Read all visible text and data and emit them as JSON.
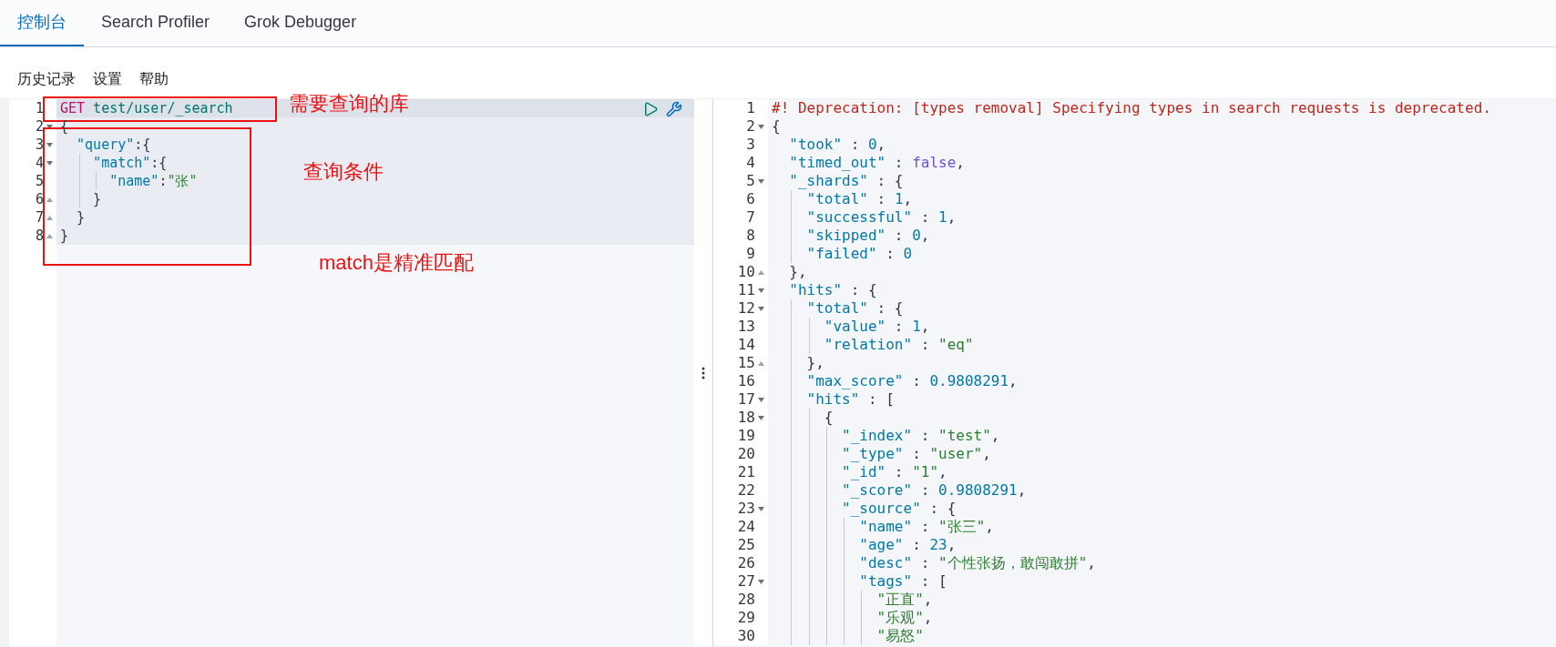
{
  "tabs": [
    {
      "label": "控制台",
      "selected": true
    },
    {
      "label": "Search Profiler",
      "selected": false
    },
    {
      "label": "Grok Debugger",
      "selected": false
    }
  ],
  "toolbar": [
    "历史记录",
    "设置",
    "帮助"
  ],
  "editor": {
    "request_selected": true,
    "lines": [
      {
        "n": "1",
        "active": true,
        "fold_start": false,
        "fold_end": false,
        "tokens": [
          {
            "kind": "method",
            "text": "GET"
          },
          {
            "kind": "path",
            "text": " test/user/_search"
          }
        ]
      },
      {
        "n": "2",
        "active": false,
        "fold_start": true,
        "fold_end": false,
        "tokens": [
          {
            "kind": "punct",
            "text": "{"
          }
        ]
      },
      {
        "n": "3",
        "active": false,
        "fold_start": true,
        "fold_end": false,
        "tokens": [
          {
            "kind": "key",
            "text": "  \"query\""
          },
          {
            "kind": "punct",
            "text": ":{"
          }
        ]
      },
      {
        "n": "4",
        "active": false,
        "fold_start": true,
        "fold_end": false,
        "tokens": [
          {
            "kind": "key",
            "text": "    \"match\""
          },
          {
            "kind": "punct",
            "text": ":{"
          }
        ]
      },
      {
        "n": "5",
        "active": false,
        "fold_start": false,
        "fold_end": false,
        "tokens": [
          {
            "kind": "key",
            "text": "      \"name\""
          },
          {
            "kind": "punct",
            "text": ":"
          },
          {
            "kind": "string",
            "text": "\"张\""
          }
        ]
      },
      {
        "n": "6",
        "active": false,
        "fold_start": false,
        "fold_end": true,
        "tokens": [
          {
            "kind": "punct",
            "text": "    }"
          }
        ]
      },
      {
        "n": "7",
        "active": false,
        "fold_start": false,
        "fold_end": true,
        "tokens": [
          {
            "kind": "punct",
            "text": "  }"
          }
        ]
      },
      {
        "n": "8",
        "active": false,
        "fold_start": false,
        "fold_end": true,
        "tokens": [
          {
            "kind": "punct",
            "text": "}"
          }
        ]
      }
    ]
  },
  "annotations": [
    "需要查询的库",
    "查询条件",
    "match是精准匹配"
  ],
  "output": {
    "lines": [
      {
        "n": "1",
        "fold_start": false,
        "fold_end": false,
        "tokens": [
          {
            "kind": "comment",
            "text": "#! Deprecation: [types removal] Specifying types in search requests is deprecated."
          }
        ]
      },
      {
        "n": "2",
        "fold_start": true,
        "fold_end": false,
        "tokens": [
          {
            "kind": "punct",
            "text": "{"
          }
        ]
      },
      {
        "n": "3",
        "fold_start": false,
        "fold_end": false,
        "tokens": [
          {
            "kind": "key",
            "text": "  \"took\""
          },
          {
            "kind": "punct",
            "text": " : "
          },
          {
            "kind": "number",
            "text": "0"
          },
          {
            "kind": "punct",
            "text": ","
          }
        ]
      },
      {
        "n": "4",
        "fold_start": false,
        "fold_end": false,
        "tokens": [
          {
            "kind": "key",
            "text": "  \"timed_out\""
          },
          {
            "kind": "punct",
            "text": " : "
          },
          {
            "kind": "bool",
            "text": "false"
          },
          {
            "kind": "punct",
            "text": ","
          }
        ]
      },
      {
        "n": "5",
        "fold_start": true,
        "fold_end": false,
        "tokens": [
          {
            "kind": "key",
            "text": "  \"_shards\""
          },
          {
            "kind": "punct",
            "text": " : {"
          }
        ]
      },
      {
        "n": "6",
        "fold_start": false,
        "fold_end": false,
        "tokens": [
          {
            "kind": "key",
            "text": "    \"total\""
          },
          {
            "kind": "punct",
            "text": " : "
          },
          {
            "kind": "number",
            "text": "1"
          },
          {
            "kind": "punct",
            "text": ","
          }
        ]
      },
      {
        "n": "7",
        "fold_start": false,
        "fold_end": false,
        "tokens": [
          {
            "kind": "key",
            "text": "    \"successful\""
          },
          {
            "kind": "punct",
            "text": " : "
          },
          {
            "kind": "number",
            "text": "1"
          },
          {
            "kind": "punct",
            "text": ","
          }
        ]
      },
      {
        "n": "8",
        "fold_start": false,
        "fold_end": false,
        "tokens": [
          {
            "kind": "key",
            "text": "    \"skipped\""
          },
          {
            "kind": "punct",
            "text": " : "
          },
          {
            "kind": "number",
            "text": "0"
          },
          {
            "kind": "punct",
            "text": ","
          }
        ]
      },
      {
        "n": "9",
        "fold_start": false,
        "fold_end": false,
        "tokens": [
          {
            "kind": "key",
            "text": "    \"failed\""
          },
          {
            "kind": "punct",
            "text": " : "
          },
          {
            "kind": "number",
            "text": "0"
          }
        ]
      },
      {
        "n": "10",
        "fold_start": false,
        "fold_end": true,
        "tokens": [
          {
            "kind": "punct",
            "text": "  },"
          }
        ]
      },
      {
        "n": "11",
        "fold_start": true,
        "fold_end": false,
        "tokens": [
          {
            "kind": "key",
            "text": "  \"hits\""
          },
          {
            "kind": "punct",
            "text": " : {"
          }
        ]
      },
      {
        "n": "12",
        "fold_start": true,
        "fold_end": false,
        "tokens": [
          {
            "kind": "key",
            "text": "    \"total\""
          },
          {
            "kind": "punct",
            "text": " : {"
          }
        ]
      },
      {
        "n": "13",
        "fold_start": false,
        "fold_end": false,
        "tokens": [
          {
            "kind": "key",
            "text": "      \"value\""
          },
          {
            "kind": "punct",
            "text": " : "
          },
          {
            "kind": "number",
            "text": "1"
          },
          {
            "kind": "punct",
            "text": ","
          }
        ]
      },
      {
        "n": "14",
        "fold_start": false,
        "fold_end": false,
        "tokens": [
          {
            "kind": "key",
            "text": "      \"relation\""
          },
          {
            "kind": "punct",
            "text": " : "
          },
          {
            "kind": "string",
            "text": "\"eq\""
          }
        ]
      },
      {
        "n": "15",
        "fold_start": false,
        "fold_end": true,
        "tokens": [
          {
            "kind": "punct",
            "text": "    },"
          }
        ]
      },
      {
        "n": "16",
        "fold_start": false,
        "fold_end": false,
        "tokens": [
          {
            "kind": "key",
            "text": "    \"max_score\""
          },
          {
            "kind": "punct",
            "text": " : "
          },
          {
            "kind": "number",
            "text": "0.9808291"
          },
          {
            "kind": "punct",
            "text": ","
          }
        ]
      },
      {
        "n": "17",
        "fold_start": true,
        "fold_end": false,
        "tokens": [
          {
            "kind": "key",
            "text": "    \"hits\""
          },
          {
            "kind": "punct",
            "text": " : ["
          }
        ]
      },
      {
        "n": "18",
        "fold_start": true,
        "fold_end": false,
        "tokens": [
          {
            "kind": "punct",
            "text": "      {"
          }
        ]
      },
      {
        "n": "19",
        "fold_start": false,
        "fold_end": false,
        "tokens": [
          {
            "kind": "key",
            "text": "        \"_index\""
          },
          {
            "kind": "punct",
            "text": " : "
          },
          {
            "kind": "string",
            "text": "\"test\""
          },
          {
            "kind": "punct",
            "text": ","
          }
        ]
      },
      {
        "n": "20",
        "fold_start": false,
        "fold_end": false,
        "tokens": [
          {
            "kind": "key",
            "text": "        \"_type\""
          },
          {
            "kind": "punct",
            "text": " : "
          },
          {
            "kind": "string",
            "text": "\"user\""
          },
          {
            "kind": "punct",
            "text": ","
          }
        ]
      },
      {
        "n": "21",
        "fold_start": false,
        "fold_end": false,
        "tokens": [
          {
            "kind": "key",
            "text": "        \"_id\""
          },
          {
            "kind": "punct",
            "text": " : "
          },
          {
            "kind": "string",
            "text": "\"1\""
          },
          {
            "kind": "punct",
            "text": ","
          }
        ]
      },
      {
        "n": "22",
        "fold_start": false,
        "fold_end": false,
        "tokens": [
          {
            "kind": "key",
            "text": "        \"_score\""
          },
          {
            "kind": "punct",
            "text": " : "
          },
          {
            "kind": "number",
            "text": "0.9808291"
          },
          {
            "kind": "punct",
            "text": ","
          }
        ]
      },
      {
        "n": "23",
        "fold_start": true,
        "fold_end": false,
        "tokens": [
          {
            "kind": "key",
            "text": "        \"_source\""
          },
          {
            "kind": "punct",
            "text": " : {"
          }
        ]
      },
      {
        "n": "24",
        "fold_start": false,
        "fold_end": false,
        "tokens": [
          {
            "kind": "key",
            "text": "          \"name\""
          },
          {
            "kind": "punct",
            "text": " : "
          },
          {
            "kind": "string",
            "text": "\"张三\""
          },
          {
            "kind": "punct",
            "text": ","
          }
        ]
      },
      {
        "n": "25",
        "fold_start": false,
        "fold_end": false,
        "tokens": [
          {
            "kind": "key",
            "text": "          \"age\""
          },
          {
            "kind": "punct",
            "text": " : "
          },
          {
            "kind": "number",
            "text": "23"
          },
          {
            "kind": "punct",
            "text": ","
          }
        ]
      },
      {
        "n": "26",
        "fold_start": false,
        "fold_end": false,
        "tokens": [
          {
            "kind": "key",
            "text": "          \"desc\""
          },
          {
            "kind": "punct",
            "text": " : "
          },
          {
            "kind": "string",
            "text": "\"个性张扬，敢闯敢拼\""
          },
          {
            "kind": "punct",
            "text": ","
          }
        ]
      },
      {
        "n": "27",
        "fold_start": true,
        "fold_end": false,
        "tokens": [
          {
            "kind": "key",
            "text": "          \"tags\""
          },
          {
            "kind": "punct",
            "text": " : ["
          }
        ]
      },
      {
        "n": "28",
        "fold_start": false,
        "fold_end": false,
        "tokens": [
          {
            "kind": "string",
            "text": "            \"正直\""
          },
          {
            "kind": "punct",
            "text": ","
          }
        ]
      },
      {
        "n": "29",
        "fold_start": false,
        "fold_end": false,
        "tokens": [
          {
            "kind": "string",
            "text": "            \"乐观\""
          },
          {
            "kind": "punct",
            "text": ","
          }
        ]
      },
      {
        "n": "30",
        "fold_start": false,
        "fold_end": false,
        "tokens": [
          {
            "kind": "string",
            "text": "            \"易怒\""
          }
        ]
      }
    ]
  }
}
